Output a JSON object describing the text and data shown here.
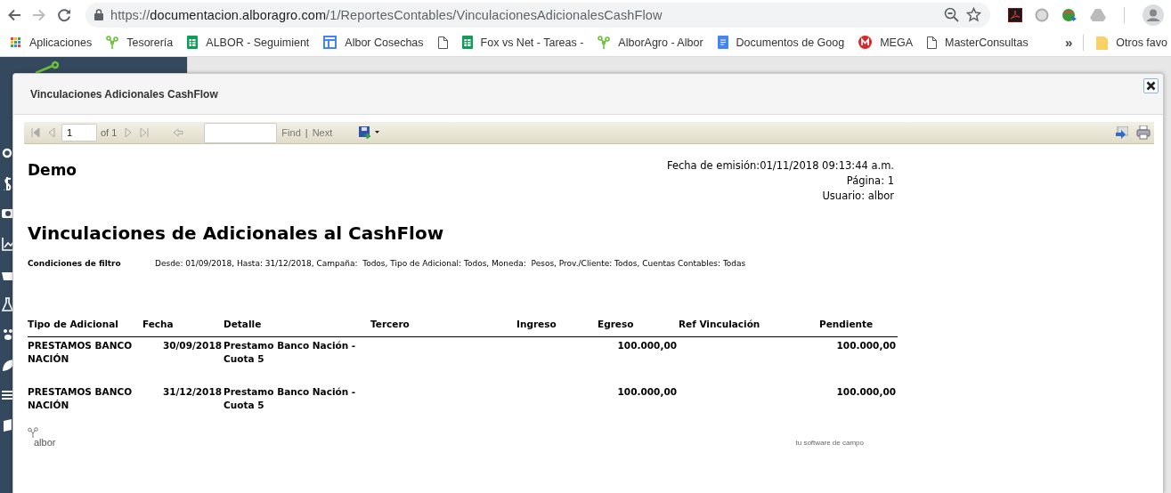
{
  "browser": {
    "url": {
      "scheme": "https://",
      "host": "documentacion.alboragro.com",
      "path": "/1/ReportesContables/VinculacionesAdicionalesCashFlow"
    },
    "bookmarks": [
      {
        "label": "Aplicaciones",
        "kind": "apps"
      },
      {
        "label": "Tesorería",
        "kind": "tree"
      },
      {
        "label": "ALBOR - Seguimient",
        "kind": "sheet"
      },
      {
        "label": "Albor Cosechas",
        "kind": "board"
      },
      {
        "kind": "page"
      },
      {
        "label": "Fox vs Net - Tareas -",
        "kind": "sheet"
      },
      {
        "label": "AlborAgro - Albor",
        "kind": "tree"
      },
      {
        "label": "Documentos de Goog",
        "kind": "doc"
      },
      {
        "label": "MEGA",
        "kind": "mega"
      },
      {
        "label": "MasterConsultas",
        "kind": "page"
      }
    ],
    "more": "»",
    "other_folder": "Otros favo"
  },
  "dialog": {
    "title": "Vinculaciones Adicionales CashFlow",
    "toolbar": {
      "page": "1",
      "page_count": "of 1",
      "find": "Find",
      "separator": "|",
      "next": "Next"
    },
    "report": {
      "company": "Demo",
      "meta": [
        "Fecha de emisión:01/11/2018 09:13:44 a.m.",
        "Página: 1",
        "Usuario: albor"
      ],
      "title": "Vinculaciones de Adicionales al CashFlow",
      "filter_label": "Condiciones de filtro",
      "filter_text": "Desde: 01/09/2018, Hasta: 31/12/2018, Campaña:  Todos, Tipo de Adicional: Todos, Moneda:  Pesos, Prov./Cliente: Todos, Cuentas Contables: Todas",
      "columns": [
        {
          "label": "Tipo de Adicional",
          "kind": "text"
        },
        {
          "label": "Fecha",
          "kind": "date"
        },
        {
          "label": "Detalle",
          "kind": "text"
        },
        {
          "label": "Tercero",
          "kind": "text"
        },
        {
          "label": "Ingreso",
          "kind": "amount"
        },
        {
          "label": "Egreso",
          "kind": "amount"
        },
        {
          "label": "Ref Vinculación",
          "kind": "text"
        },
        {
          "label": "Pendiente",
          "kind": "amount"
        }
      ],
      "rows": [
        {
          "cells": [
            "PRESTAMOS BANCO NACIÓN",
            "30/09/2018",
            "Prestamo Banco Nación - Cuota 5",
            null,
            null,
            "100.000,00",
            null,
            "100.000,00"
          ]
        },
        {
          "cells": [
            "PRESTAMOS BANCO NACIÓN",
            "31/12/2018",
            "Prestamo Banco Nación - Cuota 5",
            null,
            null,
            "100.000,00",
            null,
            "100.000,00"
          ]
        }
      ],
      "footer": {
        "logo": "albor",
        "tagline": "tu software de campo"
      }
    }
  }
}
